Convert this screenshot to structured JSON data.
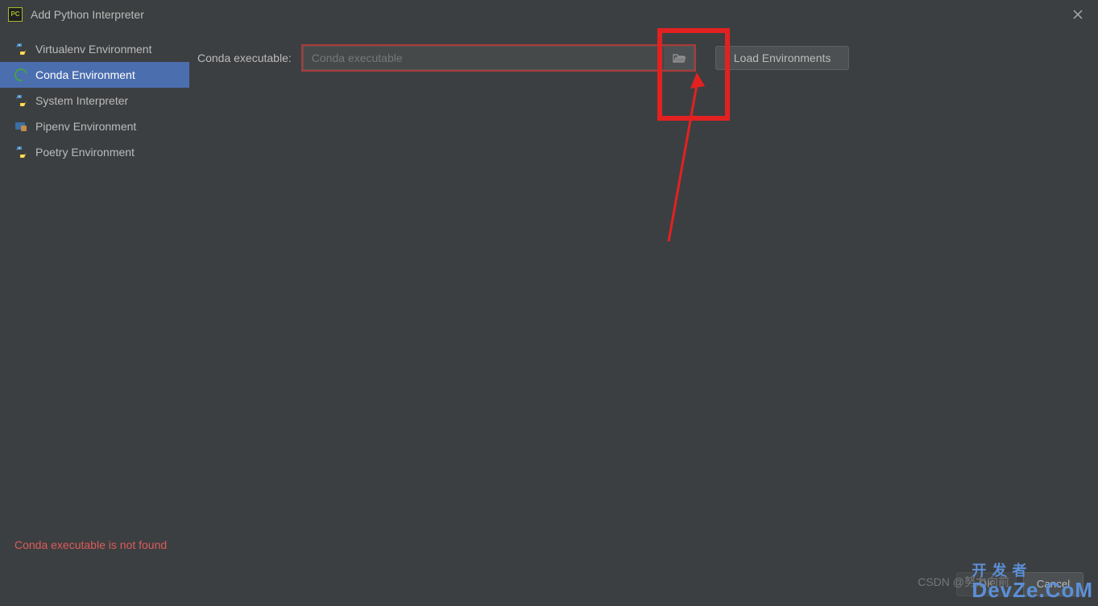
{
  "window": {
    "title": "Add Python Interpreter",
    "app_icon_text": "PC"
  },
  "sidebar": {
    "items": [
      {
        "label": "Virtualenv Environment",
        "icon": "python"
      },
      {
        "label": "Conda Environment",
        "icon": "conda",
        "selected": true
      },
      {
        "label": "System Interpreter",
        "icon": "python"
      },
      {
        "label": "Pipenv Environment",
        "icon": "pipenv"
      },
      {
        "label": "Poetry Environment",
        "icon": "python"
      }
    ]
  },
  "form": {
    "conda_label": "Conda executable:",
    "conda_placeholder": "Conda executable",
    "conda_value": "",
    "load_button": "Load Environments"
  },
  "error": "Conda executable is not found",
  "footer": {
    "ok": "OK",
    "cancel": "Cancel"
  },
  "watermark": {
    "csdn": "CSDN @努力向前",
    "brand_top": "开 发 者",
    "brand": "DevZe.CoM"
  }
}
